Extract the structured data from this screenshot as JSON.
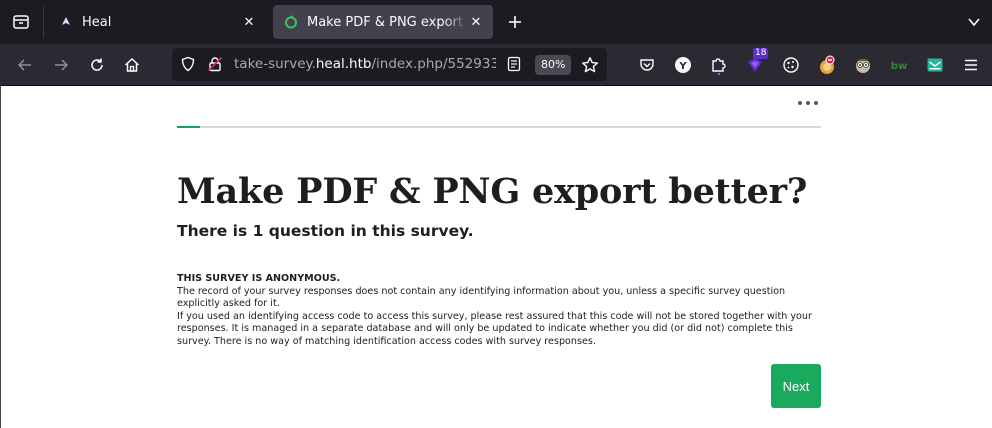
{
  "browser": {
    "tabs": [
      {
        "title": "Heal",
        "active": false
      },
      {
        "title": "Make PDF & PNG export better?",
        "active": true
      }
    ],
    "url": {
      "prefix": "take-survey.",
      "host": "heal.htb",
      "path": "/index.php/552933?"
    },
    "zoom": "80%",
    "extension_badge": "18",
    "accent_color": "#1aaa5e"
  },
  "survey": {
    "title": "Make PDF & PNG export better?",
    "question_count_text": "There is 1 question in this survey.",
    "anonymous_heading": "THIS SURVEY IS ANONYMOUS.",
    "anonymous_paragraph_1": "The record of your survey responses does not contain any identifying information about you, unless a specific survey question explicitly asked for it.",
    "anonymous_paragraph_2": "If you used an identifying access code to access this survey, please rest assured that this code will not be stored together with your responses. It is managed in a separate database and will only be updated to indicate whether you did (or did not) complete this survey. There is no way of matching identification access codes with survey responses.",
    "next_label": "Next",
    "progress_fraction": 0.035
  }
}
